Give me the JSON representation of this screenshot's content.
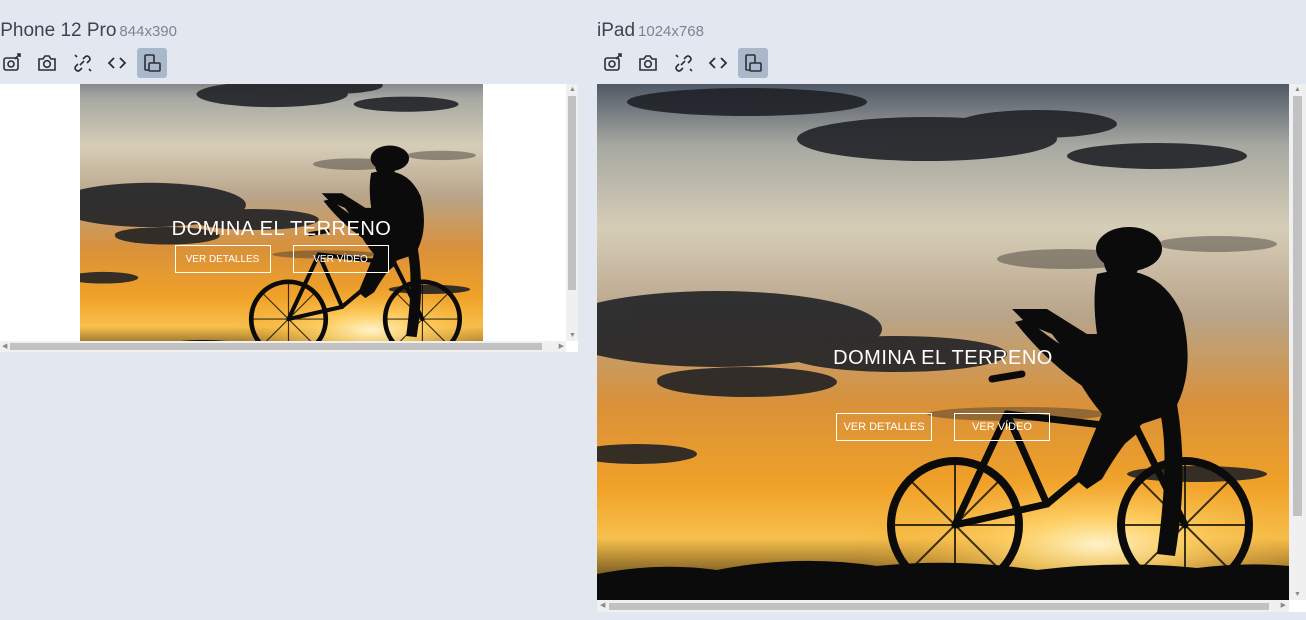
{
  "devices": [
    {
      "name": "iPhone 12 Pro",
      "dimensions": "844x390",
      "hero": {
        "title": "DOMINA EL TERRENO",
        "button_primary": "VER DETALLES",
        "button_secondary": "VER VÍDEO"
      }
    },
    {
      "name": "iPad",
      "dimensions": "1024x768",
      "hero": {
        "title": "DOMINA EL TERRENO",
        "button_primary": "VER DETALLES",
        "button_secondary": "VER VÍDEO"
      }
    }
  ],
  "toolbar_icons": [
    "screenshot-edit-icon",
    "camera-icon",
    "disconnect-icon",
    "code-icon",
    "rotate-device-icon"
  ],
  "colors": {
    "background": "#e3e8f0",
    "active_tool": "#aab8cb",
    "sunset_orange": "#f19a22",
    "silhouette": "#0b0b0b"
  }
}
